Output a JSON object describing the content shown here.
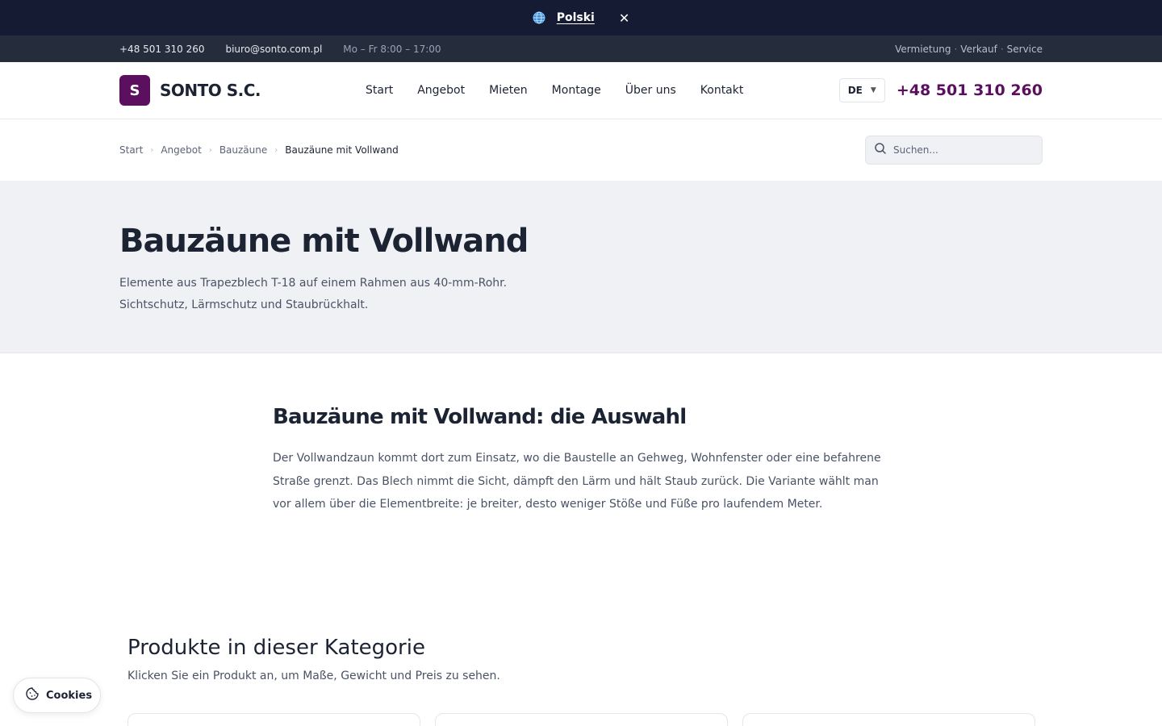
{
  "lang_banner": {
    "language": "Polski",
    "close": "✕"
  },
  "topbar": {
    "phone": "+48 501 310 260",
    "email": "biuro@sonto.com.pl",
    "hours": "Mo – Fr 8:00 – 17:00",
    "services": [
      "Vermietung",
      "Verkauf",
      "Service"
    ],
    "separator": "·"
  },
  "header": {
    "logo_mark": "S",
    "logo_text": "SONTO S.C.",
    "nav": [
      "Start",
      "Angebot",
      "Mieten",
      "Montage",
      "Über uns",
      "Kontakt"
    ],
    "lang_code": "DE",
    "lang_chevron": "▼",
    "phone": "+48 501 310 260"
  },
  "breadcrumb": {
    "items": [
      "Start",
      "Angebot",
      "Bauzäune"
    ],
    "current": "Bauzäune mit Vollwand",
    "separator": "›"
  },
  "search": {
    "placeholder": "Suchen..."
  },
  "hero": {
    "title": "Bauzäune mit Vollwand",
    "subtitle_line1": "Elemente aus Trapezblech T-18 auf einem Rahmen aus 40-mm-Rohr.",
    "subtitle_line2": "Sichtschutz, Lärmschutz und Staubrückhalt."
  },
  "content": {
    "heading": "Bauzäune mit Vollwand: die Auswahl",
    "line1": "Der Vollwandzaun kommt dort zum Einsatz, wo die Baustelle an Gehweg, Wohnfenster oder eine befahrene",
    "line2": "Straße grenzt. Das Blech nimmt die Sicht, dämpft den Lärm und hält Staub zurück. Die Variante wählt man",
    "line3": "vor allem über die Elementbreite: je breiter, desto weniger Stöße und Füße pro laufendem Meter."
  },
  "products": {
    "heading": "Produkte in dieser Kategorie",
    "hint": "Klicken Sie ein Produkt an, um Maße, Gewicht und Preis zu sehen."
  },
  "cookie": {
    "label": "Cookies"
  },
  "colors": {
    "brand": "#5c0f5e",
    "banner": "#141b33",
    "topbar": "#252c3c"
  }
}
